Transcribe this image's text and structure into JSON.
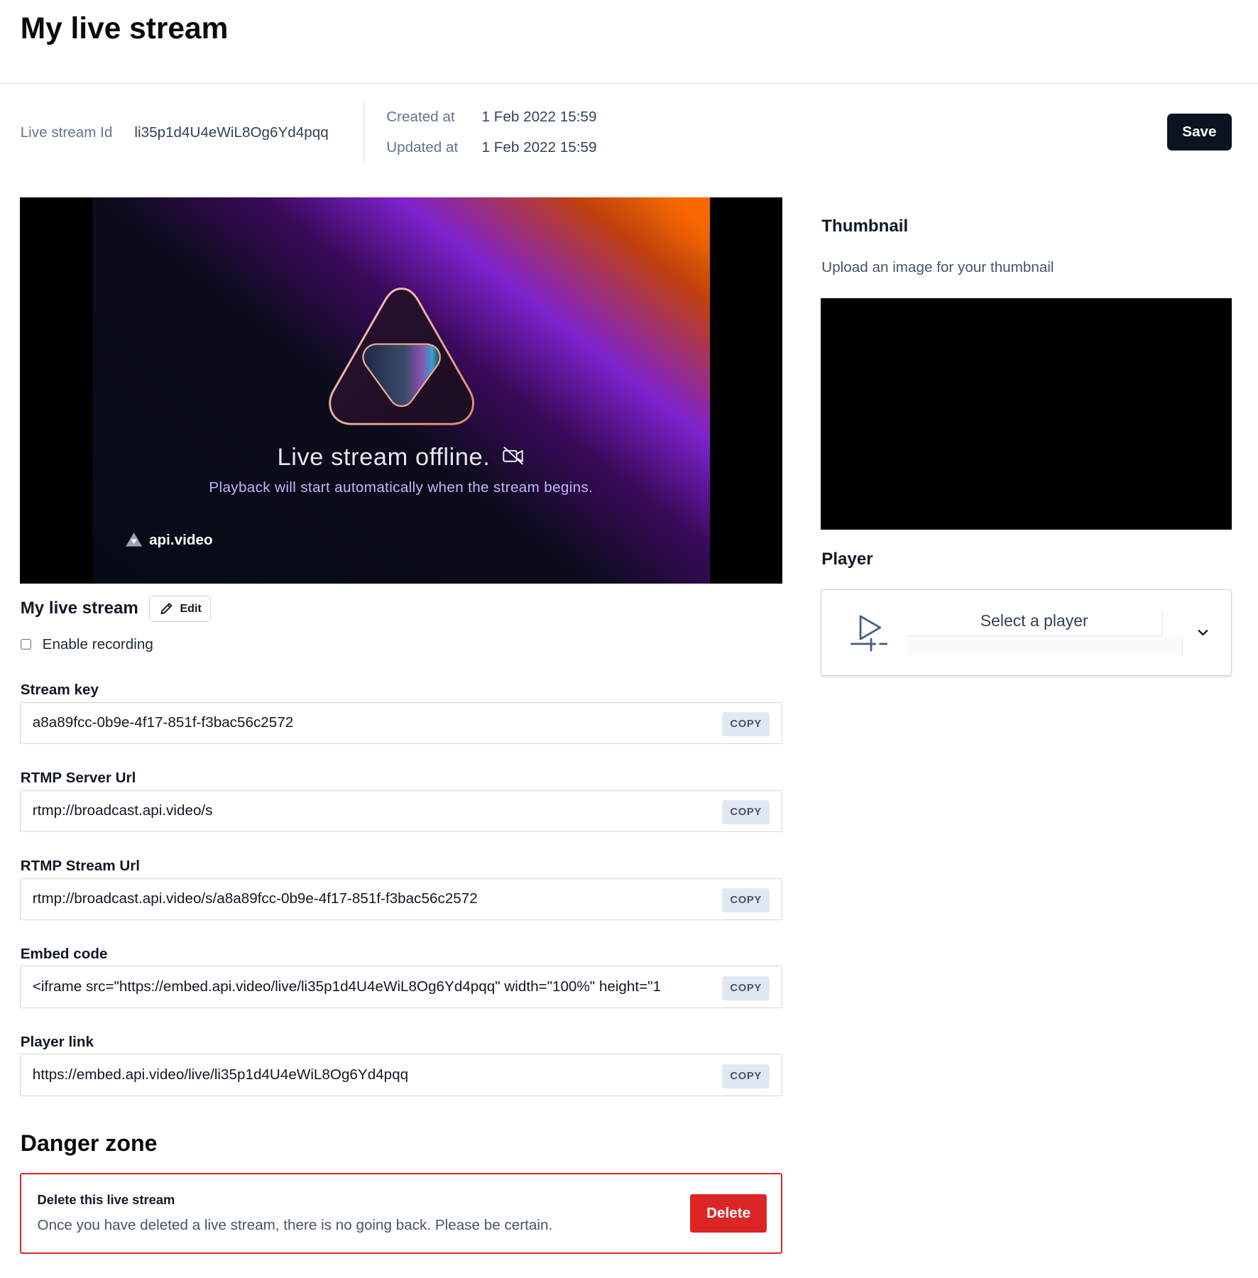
{
  "page": {
    "title": "My live stream"
  },
  "meta": {
    "id_label": "Live stream Id",
    "id_value": "li35p1d4U4eWiL8Og6Yd4pqq",
    "created_label": "Created at",
    "created_value": "1 Feb 2022 15:59",
    "updated_label": "Updated at",
    "updated_value": "1 Feb 2022 15:59"
  },
  "toolbar": {
    "save_label": "Save"
  },
  "video": {
    "offline_text": "Live stream offline.",
    "playback_text": "Playback will start automatically when the stream begins.",
    "brand": "api.video"
  },
  "stream": {
    "name": "My live stream",
    "edit_label": "Edit",
    "recording_label": "Enable recording",
    "recording_enabled": false
  },
  "fields": [
    {
      "label": "Stream key",
      "value": "a8a89fcc-0b9e-4f17-851f-f3bac56c2572",
      "copy_label": "COPY"
    },
    {
      "label": "RTMP Server Url",
      "value": "rtmp://broadcast.api.video/s",
      "copy_label": "COPY"
    },
    {
      "label": "RTMP Stream Url",
      "value": "rtmp://broadcast.api.video/s/a8a89fcc-0b9e-4f17-851f-f3bac56c2572",
      "copy_label": "COPY"
    },
    {
      "label": "Embed code",
      "value": "<iframe src=\"https://embed.api.video/live/li35p1d4U4eWiL8Og6Yd4pqq\" width=\"100%\" height=\"1",
      "copy_label": "COPY"
    },
    {
      "label": "Player link",
      "value": "https://embed.api.video/live/li35p1d4U4eWiL8Og6Yd4pqq",
      "copy_label": "COPY"
    }
  ],
  "danger": {
    "title": "Danger zone",
    "heading": "Delete this live stream",
    "text": "Once you have deleted a live stream, there is no going back. Please be certain.",
    "delete_label": "Delete"
  },
  "thumbnail": {
    "title": "Thumbnail",
    "description": "Upload an image for your thumbnail"
  },
  "player": {
    "title": "Player",
    "select_placeholder": "Select a player"
  },
  "icons": {
    "edit": "pencil-icon",
    "offline": "camera-off-icon",
    "player": "play-outline-icon",
    "dropdown": "chevron-down-icon",
    "logo": "api-video-logo"
  },
  "colors": {
    "primary_dark": "#0b1220",
    "danger": "#dc2626",
    "copy_bg": "#e2e8f0",
    "muted_text": "#64748b"
  }
}
